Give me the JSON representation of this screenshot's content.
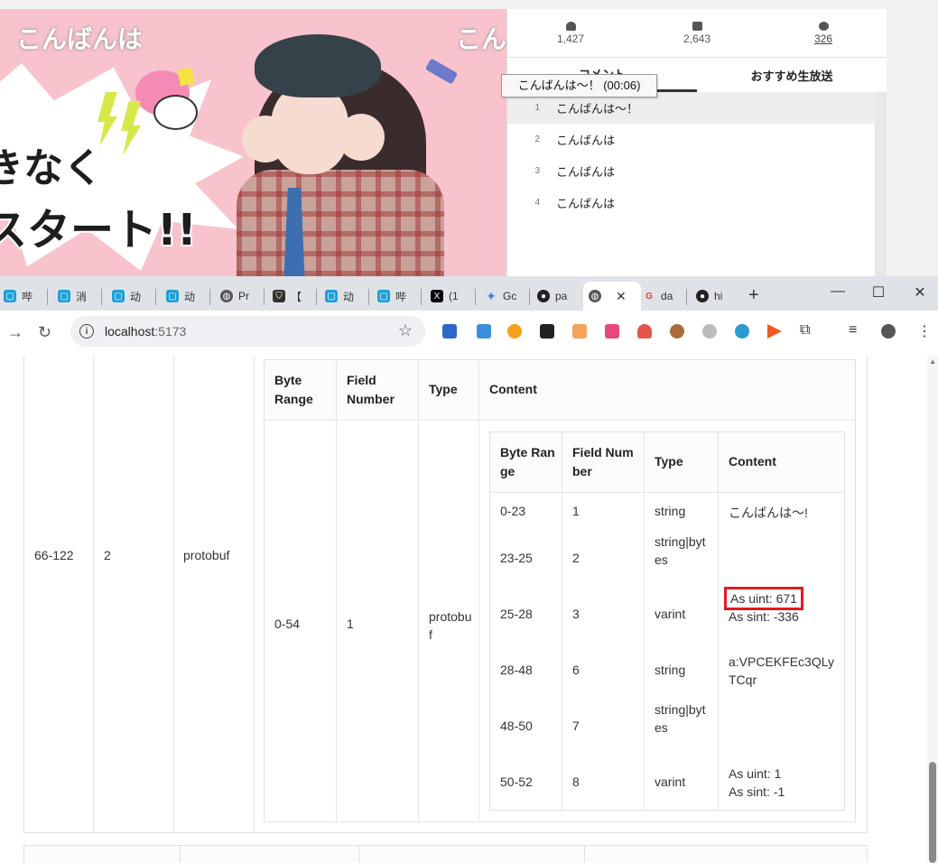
{
  "stream": {
    "overlay_text": "こんばんは",
    "overlay_text_right": "こん",
    "big_text_1": "きなく",
    "big_text_2": "スタート!!",
    "stats": [
      {
        "icon": "person-icon",
        "value": "1,427"
      },
      {
        "icon": "comment-icon",
        "value": "2,643"
      },
      {
        "icon": "clock-icon",
        "value": "326"
      }
    ],
    "tabs": [
      {
        "label": "コメント"
      },
      {
        "label": "おすすめ生放送"
      }
    ],
    "comments": [
      {
        "num": "1",
        "text": "こんばんは〜！"
      },
      {
        "num": "2",
        "text": "こんばんは"
      },
      {
        "num": "3",
        "text": "こんばんは"
      },
      {
        "num": "4",
        "text": "こんばんは"
      }
    ],
    "tooltip": "こんばんは〜！ (00:06)"
  },
  "browser": {
    "tabs": [
      {
        "icon": "bilibili-icon",
        "title": "哔",
        "color": "#1e9fd8"
      },
      {
        "icon": "bilibili-icon",
        "title": "消",
        "color": "#1e9fd8"
      },
      {
        "icon": "bilibili-icon",
        "title": "动",
        "color": "#1e9fd8"
      },
      {
        "icon": "bilibili-icon",
        "title": "动",
        "color": "#1e9fd8"
      },
      {
        "icon": "globe-icon",
        "title": "Pr",
        "color": "#555555"
      },
      {
        "icon": "shield-icon",
        "title": "【",
        "color": "#333333"
      },
      {
        "icon": "bilibili-icon",
        "title": "动",
        "color": "#1e9fd8"
      },
      {
        "icon": "bilibili-icon",
        "title": "哔",
        "color": "#1e9fd8"
      },
      {
        "icon": "x-icon",
        "title": "(1",
        "color": "#000000"
      },
      {
        "icon": "gemini-icon",
        "title": "Gc",
        "color": "#4a7be8"
      },
      {
        "icon": "github-icon",
        "title": "pa",
        "color": "#222222"
      },
      {
        "icon": "globe-icon",
        "title": "",
        "color": "#555555",
        "active": true
      },
      {
        "icon": "google-icon",
        "title": "da",
        "color": "#e94235"
      },
      {
        "icon": "github-icon",
        "title": "hi",
        "color": "#222222"
      }
    ],
    "url_host": "localhost",
    "url_port": ":5173"
  },
  "table": {
    "outer_row": {
      "byte_range": "66-122",
      "field_number": "2",
      "type": "protobuf"
    },
    "headers": {
      "byte_range": "Byte Range",
      "field_number": "Field Number",
      "type": "Type",
      "content": "Content"
    },
    "mid_row": {
      "byte_range": "0-54",
      "field_number": "1",
      "type": "protobuf"
    },
    "inner_rows": [
      {
        "byte_range": "0-23",
        "field_number": "1",
        "type": "string",
        "content": [
          "こんばんは〜!"
        ]
      },
      {
        "byte_range": "23-25",
        "field_number": "2",
        "type": "string|bytes",
        "content": []
      },
      {
        "byte_range": "25-28",
        "field_number": "3",
        "type": "varint",
        "content": [
          "As uint: 671",
          "As sint: -336"
        ]
      },
      {
        "byte_range": "28-48",
        "field_number": "6",
        "type": "string",
        "content": [
          "a:VPCEKFEc3QLyTCqr"
        ]
      },
      {
        "byte_range": "48-50",
        "field_number": "7",
        "type": "string|bytes",
        "content": []
      },
      {
        "byte_range": "50-52",
        "field_number": "8",
        "type": "varint",
        "content": [
          "As uint: 1",
          "As sint: -1"
        ]
      }
    ]
  }
}
